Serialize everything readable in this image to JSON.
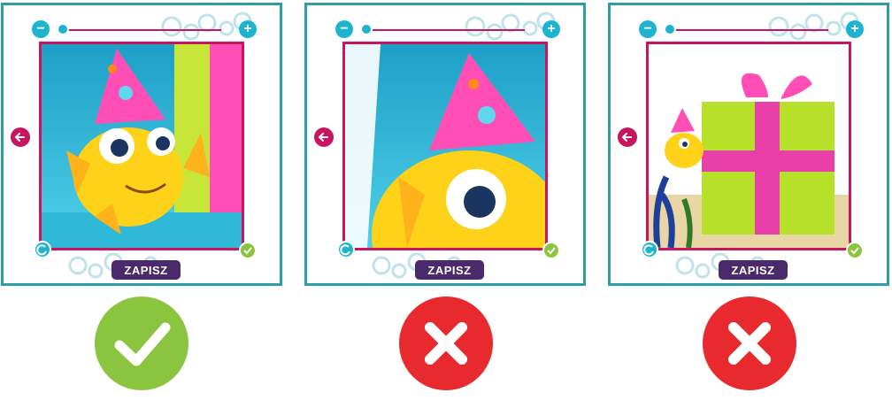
{
  "panels": [
    {
      "id": "correct",
      "save_label": "ZAPISZ",
      "verdict": "check-icon",
      "verdict_color": "#8bc53f",
      "zoom_level": 0
    },
    {
      "id": "too-close",
      "save_label": "ZAPISZ",
      "verdict": "x-icon",
      "verdict_color": "#e8292d",
      "zoom_level": 0
    },
    {
      "id": "too-far",
      "save_label": "ZAPISZ",
      "verdict": "x-icon",
      "verdict_color": "#e8292d",
      "zoom_level": 0
    }
  ],
  "colors": {
    "frame_border": "#2e9ea6",
    "photo_border": "#c9155f",
    "accent_cyan": "#1eb4d0",
    "confirm_green": "#8bc53f",
    "save_purple": "#4a2a6a",
    "error_red": "#e8292d"
  },
  "icons": {
    "zoom_out": "minus-icon",
    "zoom_in": "plus-icon",
    "back": "arrow-left-icon",
    "rotate": "rotate-icon",
    "confirm": "check-small-icon"
  }
}
